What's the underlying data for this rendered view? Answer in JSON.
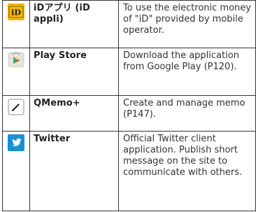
{
  "rows": [
    {
      "icon": "id-icon",
      "name": "iDアプリ (iD appli)",
      "description": "To use the electronic money of \"iD\" provided by mobile operator."
    },
    {
      "icon": "play-store-icon",
      "name": "Play Store",
      "description": "Download the application from Google Play (P120)."
    },
    {
      "icon": "pencil-icon",
      "name": "QMemo+",
      "description": "Create and manage memo (P147)."
    },
    {
      "icon": "twitter-icon",
      "name": "Twitter",
      "description": "Official Twitter client application. Publish short message on the site to communicate with others."
    }
  ],
  "colors": {
    "id_bg": "#f5b800",
    "id_text": "#1a1a1a",
    "play_bg": "#e7e4df",
    "twitter_bg": "#1a8fd6",
    "border": "#333333"
  }
}
